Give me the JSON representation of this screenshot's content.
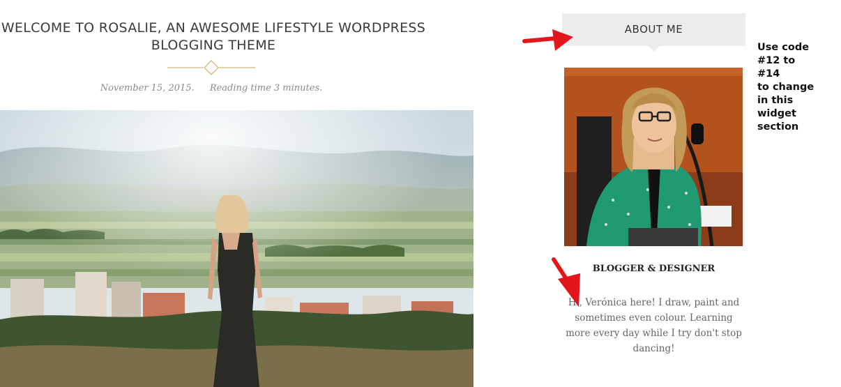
{
  "post": {
    "title": "WELCOME TO ROSALIE, AN AWESOME LIFESTYLE WORDPRESS BLOGGING THEME",
    "date": "November 15, 2015.",
    "reading_time": "Reading time 3 minutes."
  },
  "sidebar": {
    "widget_title": "ABOUT ME",
    "role": "BLOGGER & DESIGNER",
    "bio": "Hi, Verónica here! I draw, paint and sometimes even colour. Learning more every day while I try don't stop dancing!"
  },
  "annotation": {
    "lines": [
      "Use code",
      "#12 to",
      "#14",
      "to change",
      "in this",
      "widget",
      "section"
    ]
  },
  "colors": {
    "accent_gold": "#c9a65b",
    "widget_bg": "#ececec",
    "arrow_red": "#e3161b"
  }
}
